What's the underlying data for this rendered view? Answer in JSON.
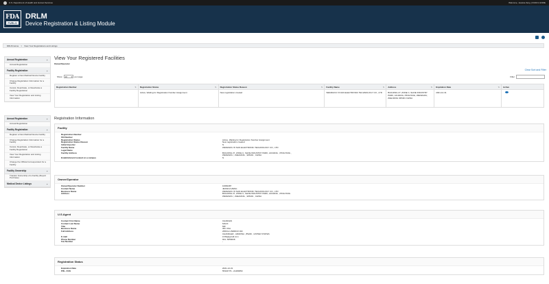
{
  "topbar": {
    "left": "U.S. Department of Health and Human Services",
    "right": "Welcome, Jessica Zeng  |  FURLS HOME"
  },
  "header": {
    "logo_top": "FDA",
    "logo_bottom": "FURLS",
    "title": "DRLM",
    "subtitle": "Device Registration & Listing Module"
  },
  "breadcrumb": {
    "home": "DRLM Home",
    "sep": ">",
    "current": "View Your Registrations and Listings"
  },
  "sidebar1": [
    {
      "head": "Annual Registration",
      "items": [
        "Annual Registration"
      ]
    },
    {
      "head": "Facility Registration",
      "items": [
        "Register a New Medical Device Facility",
        "Change Registration Information for a Facility",
        "Cancel, Deactivate, or Reactivate a Facility Registration",
        "View Your Registration and Listing Information"
      ]
    }
  ],
  "sidebar2": [
    {
      "head": "Annual Registration",
      "items": [
        "Annual Registration"
      ]
    },
    {
      "head": "Facility Registration",
      "items": [
        "Register a New Medical Device Facility",
        "Change Registration Information for a Facility",
        "Cancel, Deactivate, or Reactivate a Facility Registration",
        "View Your Registration and Listing Information",
        "Change the Official Correspondent for a Facility"
      ]
    },
    {
      "head": "Facility Ownership",
      "items": [
        "Transfer Ownership of a Facility (Report Purchase)"
      ]
    },
    {
      "head": "Medical Device Listings",
      "items": []
    }
  ],
  "main": {
    "title": "View Your Registered Facilities",
    "owner_label": "Owner/Operator",
    "clear_link": "Clear Sort and Filter",
    "show": "Show",
    "page_size": "10",
    "per_page": "per page",
    "filter": "Filter"
  },
  "table": {
    "headers": [
      "Registration Number",
      "Registration Status",
      "Registration Status Reason",
      "Facility Name",
      "Address",
      "Expiration Date",
      "Active"
    ],
    "row": [
      "",
      "Active, Waiting for Registration Number Assignment",
      "New registration created",
      "WENZHOU XI NAN ELECTRONIC TECHNOLOGY CO., LTD",
      "BUILDING 27, ZONE C, SHOE INDUSTRY PARK, AOJIANG, PINGYANG, WENZHOU, ZHEJIANG 325401 CHINA",
      "2021-12-31",
      ""
    ]
  },
  "reg_info_title": "Registration Information",
  "facility": {
    "head": "Facility",
    "rows": [
      [
        "Registration Number",
        ""
      ],
      [
        "FEI Number",
        ""
      ],
      [
        "Registration Status",
        "Active, Waiting for Registration Number Assignment"
      ],
      [
        "Registration Status Reason",
        "New registration created"
      ],
      [
        "Initial Importer",
        "N"
      ],
      [
        "Facility Name",
        "WENZHOU XI NAN ELECTRONIC TECHNOLOGY CO., LTD"
      ],
      [
        "Legal Name",
        ""
      ],
      [
        "Facility Address",
        "BUILDING 27, ZONE C, SHOE INDUSTRY PARK, AOJIANG , PINGYANG ,"
      ],
      [
        "",
        "WENZHOU , ZHEJIANG , 325401 , CHINA"
      ],
      [
        "",
        ""
      ],
      [
        "Establishment located on a campus",
        "N"
      ]
    ]
  },
  "owner": {
    "head": "Owner/Operator",
    "rows": [
      [
        "Owner/Operator Number",
        "10082487"
      ],
      [
        "Contact Name",
        "JESSICA ZENG"
      ],
      [
        "Business Name",
        "WENZHOU XI NAN ELECTRONIC TECHNOLOGY CO., LTD"
      ],
      [
        "Address",
        "BUILDING 27, ZONE C, SHOE INDUSTRY PARK, AOJIANG , PINGYANG"
      ],
      [
        "",
        "WENZHOU , ZHEJIANG , 325401 , CHINA"
      ]
    ]
  },
  "agent": {
    "head": "U.S.Agent",
    "rows": [
      [
        "Contact First Name",
        "CHARLES"
      ],
      [
        "Contact Last Name",
        "MACK"
      ],
      [
        "Title",
        "MR"
      ],
      [
        "Business Name",
        "IRC USA"
      ],
      [
        "Full Address",
        "2950 E LINDRICK DR."
      ],
      [
        "",
        "CHANDLER , ARIZONA , 85249 , UNITED STATES"
      ],
      [
        "E-mail",
        "irclhk@gmail.com"
      ],
      [
        "Phone Number",
        "931- 6256638"
      ],
      [
        "Fax Number",
        "-"
      ]
    ]
  },
  "status": {
    "head": "Registration Status",
    "rows": [
      [
        "Expiration Date",
        "2021-12-31"
      ],
      [
        "PIN - FCN",
        "55334779 - 21483959"
      ]
    ]
  }
}
